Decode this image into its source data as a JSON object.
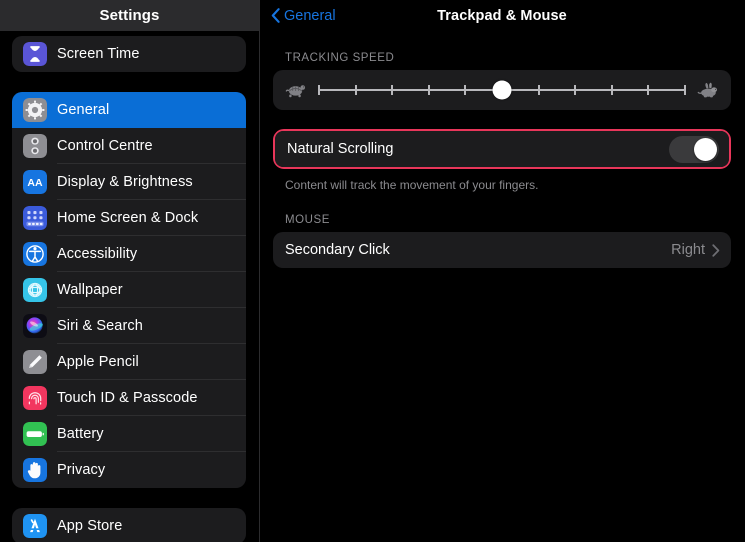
{
  "sidebar": {
    "header_title": "Settings",
    "groups": [
      {
        "id": "group-top",
        "items": [
          {
            "label": "Screen Time",
            "icon": "hourglass-icon",
            "icon_bg": "#5a55d6",
            "glyph": "⌛",
            "selected": false
          }
        ]
      },
      {
        "id": "group-system",
        "items": [
          {
            "label": "General",
            "icon": "gear-icon",
            "icon_bg": "#8e8e93",
            "glyph": "⚙",
            "selected": true
          },
          {
            "label": "Control Centre",
            "icon": "control-centre-icon",
            "icon_bg": "#8e8e93",
            "glyph": "☰",
            "selected": false
          },
          {
            "label": "Display & Brightness",
            "icon": "display-brightness-icon",
            "icon_bg": "#1775e0",
            "glyph": "AA",
            "selected": false
          },
          {
            "label": "Home Screen & Dock",
            "icon": "home-screen-dock-icon",
            "icon_bg": "#3b5bdb",
            "glyph": "∷",
            "selected": false
          },
          {
            "label": "Accessibility",
            "icon": "accessibility-icon",
            "icon_bg": "#1775e0",
            "glyph": "Ⓙ",
            "selected": false
          },
          {
            "label": "Wallpaper",
            "icon": "wallpaper-icon",
            "icon_bg": "#35c4e8",
            "glyph": "✿",
            "selected": false
          },
          {
            "label": "Siri & Search",
            "icon": "siri-search-icon",
            "icon_bg": "#111016",
            "glyph": "◉",
            "selected": false
          },
          {
            "label": "Apple Pencil",
            "icon": "apple-pencil-icon",
            "icon_bg": "#8e8e93",
            "glyph": "╱",
            "selected": false
          },
          {
            "label": "Touch ID & Passcode",
            "icon": "touch-id-passcode-icon",
            "icon_bg": "#f2365f",
            "glyph": "⊚",
            "selected": false
          },
          {
            "label": "Battery",
            "icon": "battery-icon",
            "icon_bg": "#31c152",
            "glyph": "▬",
            "selected": false
          },
          {
            "label": "Privacy",
            "icon": "privacy-icon",
            "icon_bg": "#1775e0",
            "glyph": "✋",
            "selected": false
          }
        ]
      },
      {
        "id": "group-store",
        "items": [
          {
            "label": "App Store",
            "icon": "app-store-icon",
            "icon_bg": "#1f93f2",
            "glyph": "A",
            "selected": false
          }
        ]
      }
    ]
  },
  "main": {
    "back_label": "General",
    "title": "Trackpad & Mouse",
    "sections": {
      "tracking": {
        "header": "TRACKING SPEED",
        "slow_icon": "turtle-icon",
        "fast_icon": "rabbit-icon",
        "slider": {
          "name": "tracking-speed-slider",
          "value": 5,
          "min": 0,
          "max": 10,
          "tick_count": 11
        }
      },
      "natural_scrolling": {
        "label": "Natural Scrolling",
        "toggle_state": "on",
        "footnote": "Content will track the movement of your fingers.",
        "highlight_color": "#e8365a"
      },
      "mouse": {
        "header": "MOUSE",
        "rows": [
          {
            "label": "Secondary Click",
            "value": "Right",
            "accessory": "chevron-right-icon"
          }
        ]
      }
    }
  },
  "colors": {
    "accent_blue": "#1775e0",
    "selected_row": "#0a6ed6",
    "card_bg": "#1c1c1e",
    "page_bg": "#000000",
    "secondary_text": "#8b8b8f",
    "highlight_red": "#e8365a"
  }
}
